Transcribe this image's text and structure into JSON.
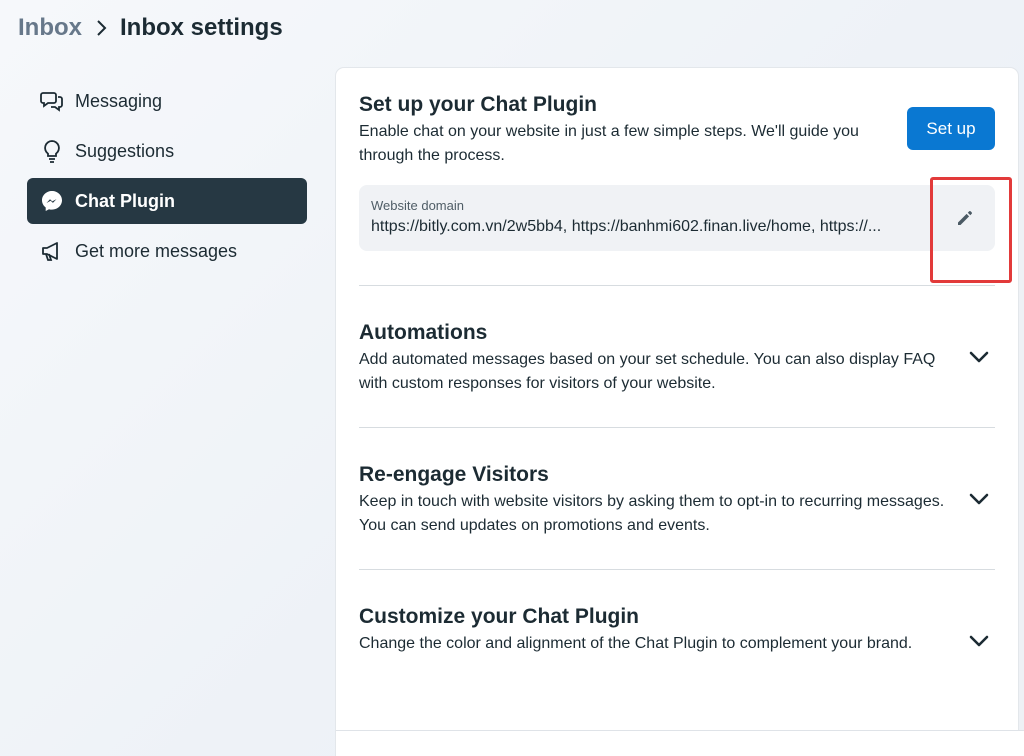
{
  "breadcrumb": {
    "root": "Inbox",
    "current": "Inbox settings"
  },
  "sidebar": {
    "items": [
      {
        "label": "Messaging",
        "icon": "chat-bubbles-icon"
      },
      {
        "label": "Suggestions",
        "icon": "lightbulb-icon"
      },
      {
        "label": "Chat Plugin",
        "icon": "messenger-icon",
        "active": true
      },
      {
        "label": "Get more messages",
        "icon": "megaphone-icon"
      }
    ]
  },
  "setup": {
    "title": "Set up your Chat Plugin",
    "description": "Enable chat on your website in just a few simple steps. We'll guide you through the process.",
    "button_label": "Set up",
    "domain_label": "Website domain",
    "domain_value": "https://bitly.com.vn/2w5bb4, https://banhmi602.finan.live/home, https://..."
  },
  "sections": [
    {
      "title": "Automations",
      "description": "Add automated messages based on your set schedule. You can also display FAQ with custom responses for visitors of your website."
    },
    {
      "title": "Re-engage Visitors",
      "description": "Keep in touch with website visitors by asking them to opt-in to recurring messages. You can send updates on promotions and events."
    },
    {
      "title": "Customize your Chat Plugin",
      "description": "Change the color and alignment of the Chat Plugin to complement your brand."
    }
  ],
  "colors": {
    "primary_button": "#0a78d2",
    "active_nav": "#263843",
    "highlight": "#e23a3a"
  }
}
